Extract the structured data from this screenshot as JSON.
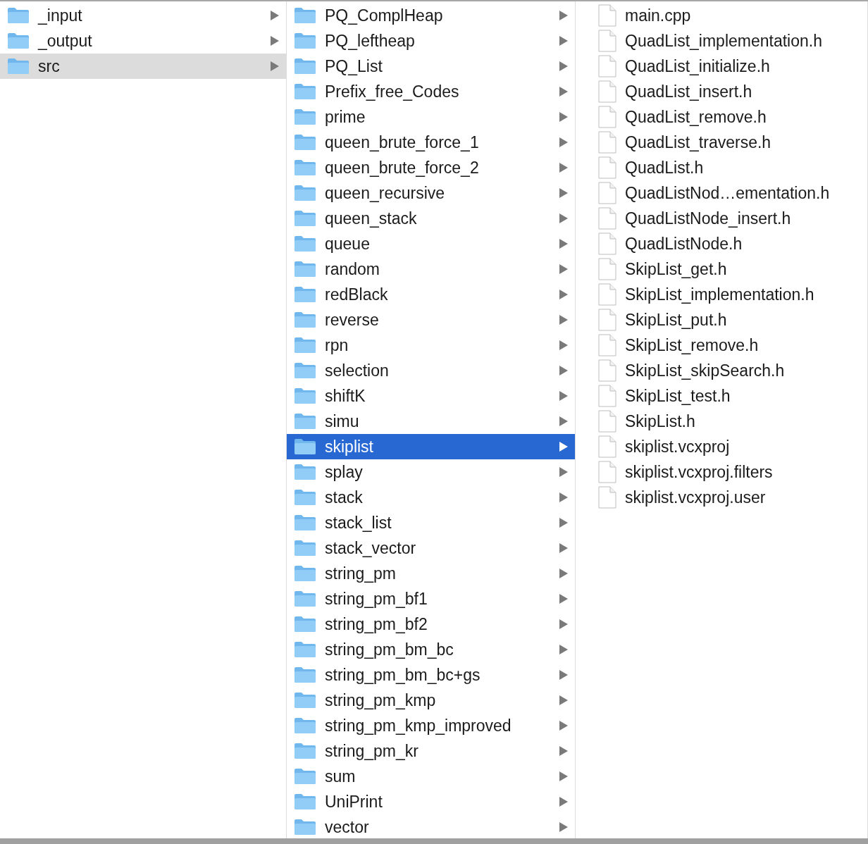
{
  "columns": [
    {
      "active": false,
      "items": [
        {
          "name": "_input",
          "kind": "folder",
          "selected": false
        },
        {
          "name": "_output",
          "kind": "folder",
          "selected": false
        },
        {
          "name": "src",
          "kind": "folder",
          "selected": true
        }
      ]
    },
    {
      "active": true,
      "items": [
        {
          "name": "PQ_ComplHeap",
          "kind": "folder",
          "selected": false
        },
        {
          "name": "PQ_leftheap",
          "kind": "folder",
          "selected": false
        },
        {
          "name": "PQ_List",
          "kind": "folder",
          "selected": false
        },
        {
          "name": "Prefix_free_Codes",
          "kind": "folder",
          "selected": false
        },
        {
          "name": "prime",
          "kind": "folder",
          "selected": false
        },
        {
          "name": "queen_brute_force_1",
          "kind": "folder",
          "selected": false
        },
        {
          "name": "queen_brute_force_2",
          "kind": "folder",
          "selected": false
        },
        {
          "name": "queen_recursive",
          "kind": "folder",
          "selected": false
        },
        {
          "name": "queen_stack",
          "kind": "folder",
          "selected": false
        },
        {
          "name": "queue",
          "kind": "folder",
          "selected": false
        },
        {
          "name": "random",
          "kind": "folder",
          "selected": false
        },
        {
          "name": "redBlack",
          "kind": "folder",
          "selected": false
        },
        {
          "name": "reverse",
          "kind": "folder",
          "selected": false
        },
        {
          "name": "rpn",
          "kind": "folder",
          "selected": false
        },
        {
          "name": "selection",
          "kind": "folder",
          "selected": false
        },
        {
          "name": "shiftK",
          "kind": "folder",
          "selected": false
        },
        {
          "name": "simu",
          "kind": "folder",
          "selected": false
        },
        {
          "name": "skiplist",
          "kind": "folder",
          "selected": true
        },
        {
          "name": "splay",
          "kind": "folder",
          "selected": false
        },
        {
          "name": "stack",
          "kind": "folder",
          "selected": false
        },
        {
          "name": "stack_list",
          "kind": "folder",
          "selected": false
        },
        {
          "name": "stack_vector",
          "kind": "folder",
          "selected": false
        },
        {
          "name": "string_pm",
          "kind": "folder",
          "selected": false
        },
        {
          "name": "string_pm_bf1",
          "kind": "folder",
          "selected": false
        },
        {
          "name": "string_pm_bf2",
          "kind": "folder",
          "selected": false
        },
        {
          "name": "string_pm_bm_bc",
          "kind": "folder",
          "selected": false
        },
        {
          "name": "string_pm_bm_bc+gs",
          "kind": "folder",
          "selected": false
        },
        {
          "name": "string_pm_kmp",
          "kind": "folder",
          "selected": false
        },
        {
          "name": "string_pm_kmp_improved",
          "kind": "folder",
          "selected": false
        },
        {
          "name": "string_pm_kr",
          "kind": "folder",
          "selected": false
        },
        {
          "name": "sum",
          "kind": "folder",
          "selected": false
        },
        {
          "name": "UniPrint",
          "kind": "folder",
          "selected": false
        },
        {
          "name": "vector",
          "kind": "folder",
          "selected": false
        }
      ]
    },
    {
      "items": [
        {
          "name": "main.cpp",
          "kind": "file",
          "selected": false
        },
        {
          "name": "QuadList_implementation.h",
          "kind": "file",
          "selected": false
        },
        {
          "name": "QuadList_initialize.h",
          "kind": "file",
          "selected": false
        },
        {
          "name": "QuadList_insert.h",
          "kind": "file",
          "selected": false
        },
        {
          "name": "QuadList_remove.h",
          "kind": "file",
          "selected": false
        },
        {
          "name": "QuadList_traverse.h",
          "kind": "file",
          "selected": false
        },
        {
          "name": "QuadList.h",
          "kind": "file",
          "selected": false
        },
        {
          "name": "QuadListNod…ementation.h",
          "kind": "file",
          "selected": false
        },
        {
          "name": "QuadListNode_insert.h",
          "kind": "file",
          "selected": false
        },
        {
          "name": "QuadListNode.h",
          "kind": "file",
          "selected": false
        },
        {
          "name": "SkipList_get.h",
          "kind": "file",
          "selected": false
        },
        {
          "name": "SkipList_implementation.h",
          "kind": "file",
          "selected": false
        },
        {
          "name": "SkipList_put.h",
          "kind": "file",
          "selected": false
        },
        {
          "name": "SkipList_remove.h",
          "kind": "file",
          "selected": false
        },
        {
          "name": "SkipList_skipSearch.h",
          "kind": "file",
          "selected": false
        },
        {
          "name": "SkipList_test.h",
          "kind": "file",
          "selected": false
        },
        {
          "name": "SkipList.h",
          "kind": "file",
          "selected": false
        },
        {
          "name": "skiplist.vcxproj",
          "kind": "file",
          "selected": false
        },
        {
          "name": "skiplist.vcxproj.filters",
          "kind": "file",
          "selected": false
        },
        {
          "name": "skiplist.vcxproj.user",
          "kind": "file",
          "selected": false
        }
      ]
    }
  ]
}
